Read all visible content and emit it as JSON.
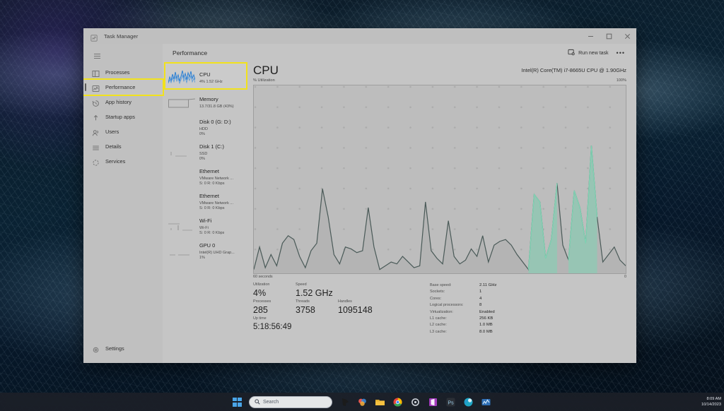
{
  "desktop": {
    "taskbar": {
      "start_icon": "windows-start-icon",
      "search_placeholder": "Search",
      "apps": [
        {
          "name": "taskbar-app-taskview",
          "icon": "task-view-icon"
        },
        {
          "name": "taskbar-app-copilot",
          "icon": "copilot-icon"
        },
        {
          "name": "taskbar-app-explorer",
          "icon": "file-explorer-icon"
        },
        {
          "name": "taskbar-app-chrome",
          "icon": "chrome-icon"
        },
        {
          "name": "taskbar-app-settings",
          "icon": "settings-icon"
        },
        {
          "name": "taskbar-app-office",
          "icon": "office-icon"
        },
        {
          "name": "taskbar-app-photoshop",
          "icon": "photoshop-icon"
        },
        {
          "name": "taskbar-app-edge",
          "icon": "edge-icon"
        },
        {
          "name": "taskbar-app-taskmanager",
          "icon": "task-manager-icon"
        }
      ],
      "clock_time": "8:09 AM",
      "clock_date": "10/14/2023"
    }
  },
  "window": {
    "title": "Task Manager",
    "icon": "task-manager-icon",
    "controls": {
      "minimize": "minimize-icon",
      "maximize": "maximize-icon",
      "close": "close-icon"
    }
  },
  "nav": {
    "menu_icon": "hamburger-icon",
    "items": [
      {
        "label": "Processes",
        "icon": "processes-icon",
        "selected": false
      },
      {
        "label": "Performance",
        "icon": "performance-icon",
        "selected": true
      },
      {
        "label": "App history",
        "icon": "app-history-icon",
        "selected": false
      },
      {
        "label": "Startup apps",
        "icon": "startup-apps-icon",
        "selected": false
      },
      {
        "label": "Users",
        "icon": "users-icon",
        "selected": false
      },
      {
        "label": "Details",
        "icon": "details-icon",
        "selected": false
      },
      {
        "label": "Services",
        "icon": "services-icon",
        "selected": false
      }
    ],
    "settings": {
      "label": "Settings",
      "icon": "gear-icon"
    }
  },
  "toolbar": {
    "page_title": "Performance",
    "run_new_task_label": "Run new task",
    "run_new_task_icon": "run-new-task-icon",
    "more_options": "•••"
  },
  "perf_list": [
    {
      "title": "CPU",
      "sub1": "4% 1.52 GHz",
      "sub2": "",
      "selected": true
    },
    {
      "title": "Memory",
      "sub1": "13.7/31.8 GB (43%)",
      "sub2": "",
      "selected": false
    },
    {
      "title": "Disk 0 (G: D:)",
      "sub1": "HDD",
      "sub2": "0%",
      "selected": false
    },
    {
      "title": "Disk 1 (C:)",
      "sub1": "SSD",
      "sub2": "0%",
      "selected": false
    },
    {
      "title": "Ethernet",
      "sub1": "VMware Network ...",
      "sub2": "S: 0 R: 0 Kbps",
      "selected": false
    },
    {
      "title": "Ethernet",
      "sub1": "VMware Network ...",
      "sub2": "S: 0 R: 0 Kbps",
      "selected": false
    },
    {
      "title": "Wi-Fi",
      "sub1": "Wi-Fi",
      "sub2": "S: 0 R: 0 Kbps",
      "selected": false
    },
    {
      "title": "GPU 0",
      "sub1": "Intel(R) UHD Grap...",
      "sub2": "1%",
      "selected": false
    }
  ],
  "detail": {
    "title": "CPU",
    "model": "Intel(R) Core(TM) i7-8665U CPU @ 1.90GHz",
    "subtitle": "% Utilization",
    "max_label": "100%",
    "axis_left": "60 seconds",
    "axis_right": "0",
    "stats_left": [
      {
        "label": "Utilization",
        "value": "4%"
      },
      {
        "label": "Speed",
        "value": "1.52 GHz"
      },
      {
        "label": "Processes",
        "value": "285"
      },
      {
        "label": "Threads",
        "value": "3758"
      },
      {
        "label": "Handles",
        "value": "1095148"
      },
      {
        "label": "Up time",
        "value": "5:18:56:49"
      }
    ],
    "stats_right": [
      {
        "label": "Base speed:",
        "value": "2.11 GHz"
      },
      {
        "label": "Sockets:",
        "value": "1"
      },
      {
        "label": "Cores:",
        "value": "4"
      },
      {
        "label": "Logical processors:",
        "value": "8"
      },
      {
        "label": "Virtualization:",
        "value": "Enabled"
      },
      {
        "label": "L1 cache:",
        "value": "256 KB"
      },
      {
        "label": "L2 cache:",
        "value": "1.0 MB"
      },
      {
        "label": "L3 cache:",
        "value": "8.0 MB"
      }
    ]
  },
  "chart_data": {
    "type": "line",
    "title": "CPU Utilization",
    "xlabel": "60 seconds",
    "ylabel": "% Utilization",
    "ylim": [
      0,
      100
    ],
    "xlim": [
      60,
      0
    ],
    "grid": true,
    "legend": false,
    "line_color": "#4a5a58",
    "fill_color": "#b4b4b4",
    "highlight_color": "#7fd4b4",
    "values": [
      2,
      14,
      3,
      10,
      4,
      16,
      20,
      18,
      9,
      3,
      12,
      16,
      45,
      30,
      10,
      5,
      14,
      13,
      11,
      12,
      35,
      14,
      2,
      4,
      6,
      5,
      9,
      6,
      3,
      4,
      38,
      12,
      8,
      5,
      28,
      9,
      5,
      7,
      13,
      9,
      20,
      6,
      15,
      17,
      18,
      15,
      10,
      6,
      2,
      42,
      38,
      8,
      18,
      48,
      15,
      7,
      44,
      35,
      16,
      68,
      30,
      6,
      10,
      14,
      7,
      4
    ]
  }
}
